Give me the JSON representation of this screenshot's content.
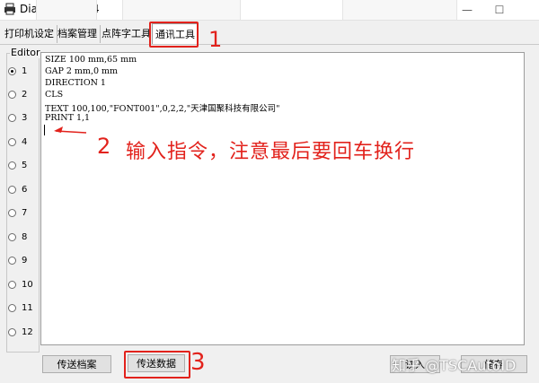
{
  "window": {
    "title": "DiagTool v1.64",
    "minimize_glyph": "—",
    "maximize_glyph": "☐"
  },
  "tabs": [
    {
      "label": "打印机设定"
    },
    {
      "label": "档案管理"
    },
    {
      "label": "点阵字工具"
    },
    {
      "label": "通讯工具"
    }
  ],
  "editor_group": {
    "title": "Editor",
    "options": [
      "1",
      "2",
      "3",
      "4",
      "5",
      "6",
      "7",
      "8",
      "9",
      "10",
      "11",
      "12"
    ],
    "selected": "1"
  },
  "editor": {
    "lines": [
      "SIZE 100 mm,65 mm",
      "GAP 2 mm,0 mm",
      "DIRECTION 1",
      "CLS",
      "TEXT 100,100,\"FONT001\",0,2,2,\"天津国聚科技有限公司\"",
      "PRINT 1,1"
    ]
  },
  "annotations": {
    "step1": "1",
    "step2": "2",
    "step2_text": "输入指令，注意最后要回车换行",
    "step3": "3"
  },
  "buttons": {
    "send_file": "传送档案",
    "send_data": "传送数据",
    "read": "读入",
    "save": "储存"
  },
  "watermark": "知乎 @TSCAutoID",
  "colors": {
    "annotation_red": "#e2221c"
  }
}
